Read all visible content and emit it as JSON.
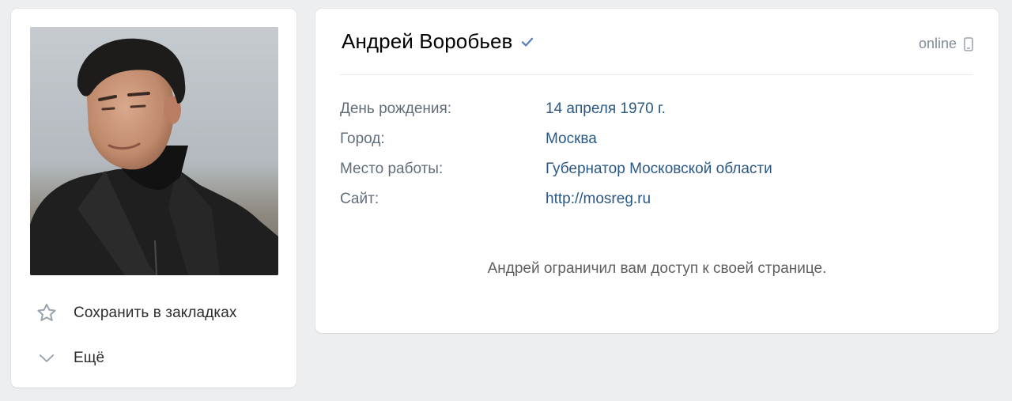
{
  "profile": {
    "name": "Андрей Воробьев",
    "verified_icon": "verified-check-icon",
    "status_text": "online",
    "status_icon": "mobile-phone-icon"
  },
  "info": [
    {
      "label": "День рождения:",
      "value": "14 апреля 1970 г."
    },
    {
      "label": "Город:",
      "value": "Москва"
    },
    {
      "label": "Место работы:",
      "value": "Губернатор Московской области"
    },
    {
      "label": "Сайт:",
      "value": "http://mosreg.ru"
    }
  ],
  "notice": "Андрей ограничил вам доступ к своей странице.",
  "actions": {
    "bookmark_label": "Сохранить в закладках",
    "bookmark_icon": "star-icon",
    "more_label": "Ещё",
    "more_icon": "chevron-down-icon"
  },
  "colors": {
    "background": "#edeef0",
    "link": "#2a5885",
    "label": "#626d7a",
    "verified": "#5181b8"
  }
}
